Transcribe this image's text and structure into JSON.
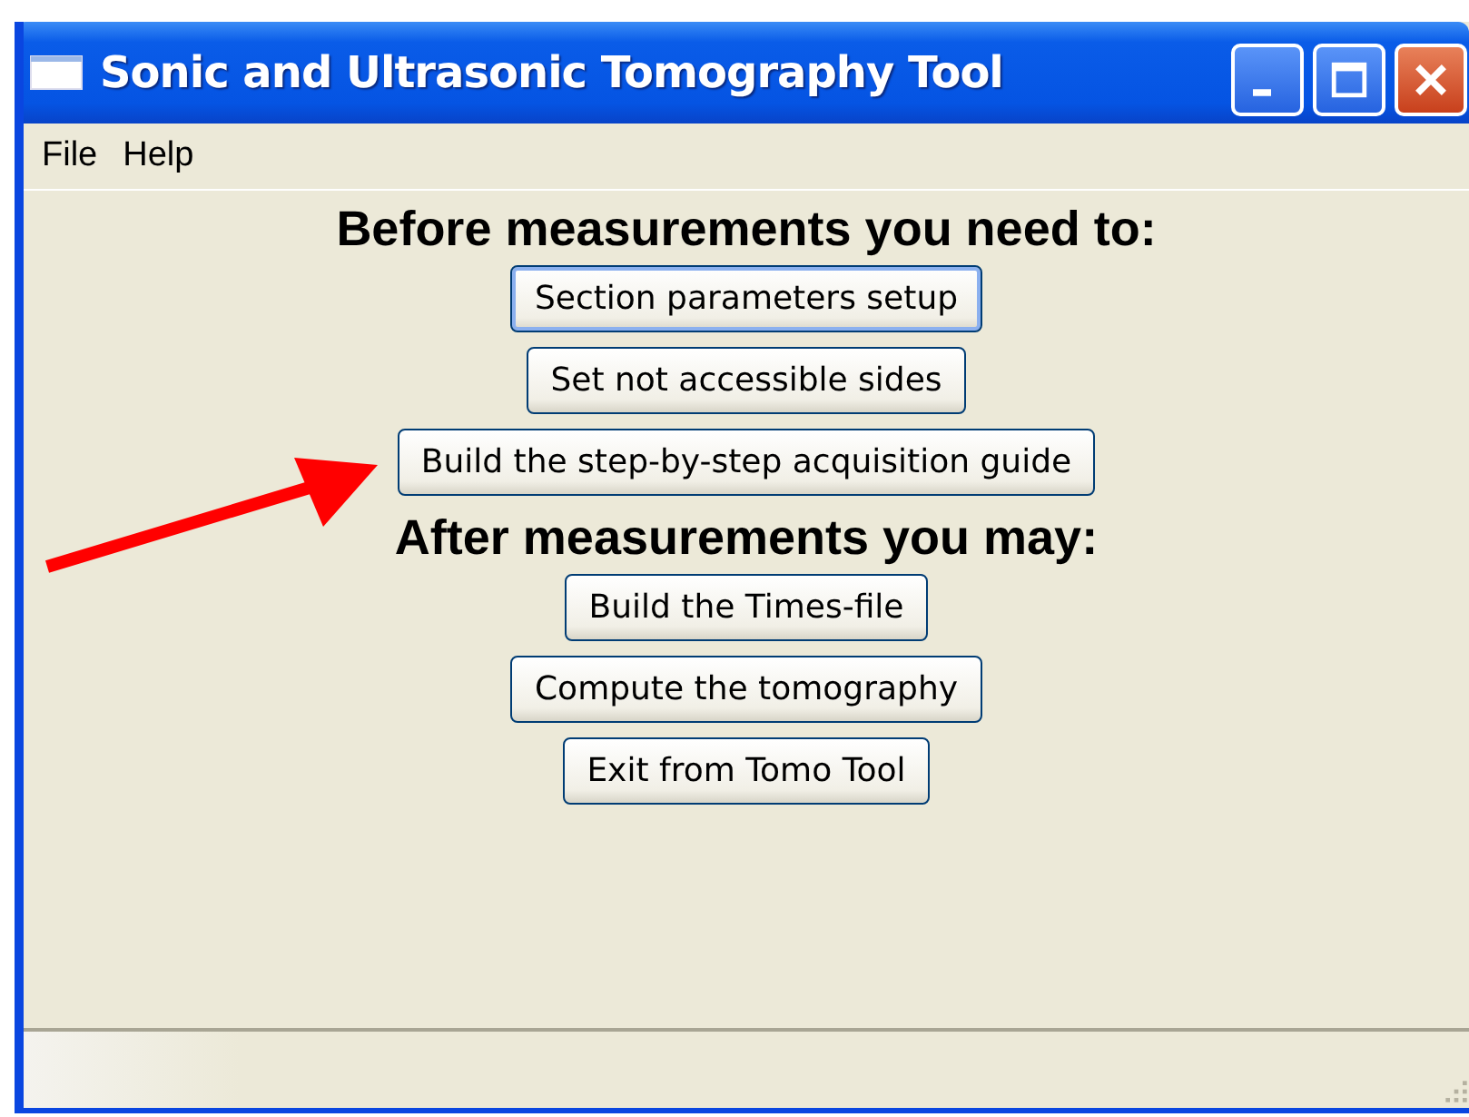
{
  "window": {
    "title": "Sonic and Ultrasonic Tomography Tool"
  },
  "menu": [
    "File",
    "Help"
  ],
  "sections": [
    {
      "heading": "Before measurements you need to:",
      "buttons": [
        {
          "label": "Section parameters setup",
          "focused": true
        },
        {
          "label": "Set not accessible sides",
          "focused": false
        },
        {
          "label": "Build the step-by-step acquisition guide",
          "focused": false
        }
      ]
    },
    {
      "heading": "After measurements you may:",
      "buttons": [
        {
          "label": "Build the Times-file",
          "focused": false
        },
        {
          "label": "Compute the tomography",
          "focused": false
        },
        {
          "label": "Exit from Tomo Tool",
          "focused": false
        }
      ]
    }
  ]
}
